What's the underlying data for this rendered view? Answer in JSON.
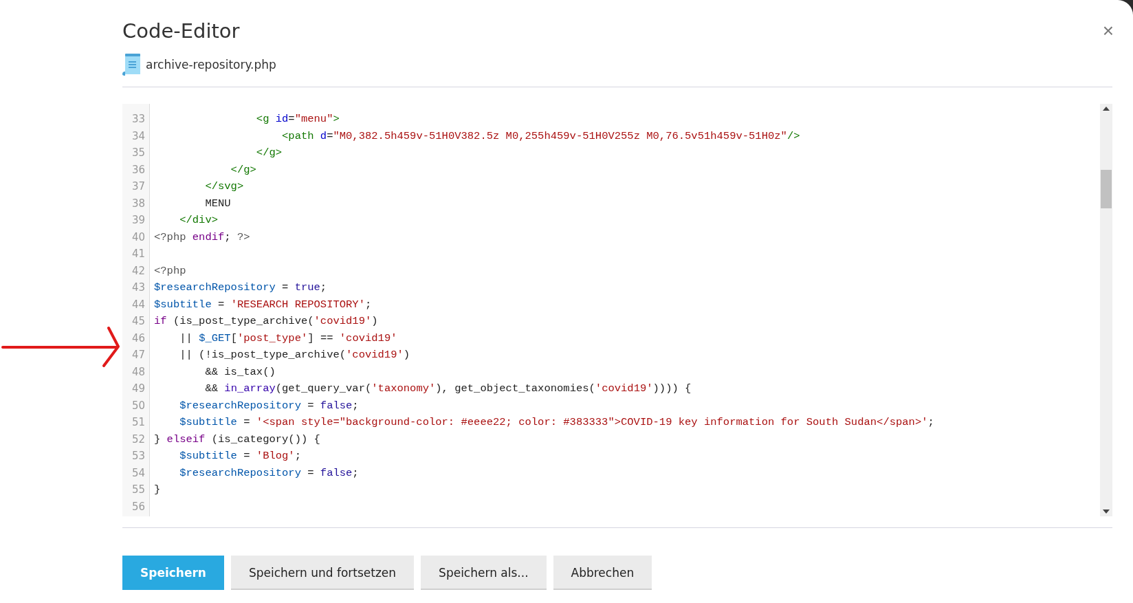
{
  "dialog": {
    "title": "Code-Editor",
    "close": "×",
    "file": {
      "name": "archive-repository.php"
    }
  },
  "editor": {
    "lines": [
      {
        "number": "33",
        "tokens": [
          {
            "kind": "tag",
            "text": "                <g "
          },
          {
            "kind": "attr",
            "text": "id"
          },
          {
            "kind": "plain",
            "text": "="
          },
          {
            "kind": "string",
            "text": "\"menu\""
          },
          {
            "kind": "tag",
            "text": ">"
          }
        ]
      },
      {
        "number": "34",
        "tokens": [
          {
            "kind": "tag",
            "text": "                    <path "
          },
          {
            "kind": "attr",
            "text": "d"
          },
          {
            "kind": "plain",
            "text": "="
          },
          {
            "kind": "string",
            "text": "\"M0,382.5h459v-51H0V382.5z M0,255h459v-51H0V255z M0,76.5v51h459v-51H0z\""
          },
          {
            "kind": "tag",
            "text": "/>"
          }
        ]
      },
      {
        "number": "35",
        "tokens": [
          {
            "kind": "tag",
            "text": "                </g>"
          }
        ]
      },
      {
        "number": "36",
        "tokens": [
          {
            "kind": "tag",
            "text": "            </g>"
          }
        ]
      },
      {
        "number": "37",
        "tokens": [
          {
            "kind": "tag",
            "text": "        </svg>"
          }
        ]
      },
      {
        "number": "38",
        "tokens": [
          {
            "kind": "plain",
            "text": "        MENU"
          }
        ]
      },
      {
        "number": "39",
        "tokens": [
          {
            "kind": "tag",
            "text": "    </div>"
          }
        ]
      },
      {
        "number": "40",
        "tokens": [
          {
            "kind": "meta",
            "text": "<?php "
          },
          {
            "kind": "keyword",
            "text": "endif"
          },
          {
            "kind": "plain",
            "text": "; "
          },
          {
            "kind": "meta",
            "text": "?>"
          }
        ]
      },
      {
        "number": "41"
      },
      {
        "number": "42",
        "tokens": [
          {
            "kind": "meta",
            "text": "<?php"
          }
        ]
      },
      {
        "number": "43",
        "tokens": [
          {
            "kind": "var",
            "text": "$researchRepository"
          },
          {
            "kind": "plain",
            "text": " = "
          },
          {
            "kind": "atom",
            "text": "true"
          },
          {
            "kind": "plain",
            "text": ";"
          }
        ]
      },
      {
        "number": "44",
        "tokens": [
          {
            "kind": "var",
            "text": "$subtitle"
          },
          {
            "kind": "plain",
            "text": " = "
          },
          {
            "kind": "string",
            "text": "'RESEARCH REPOSITORY'"
          },
          {
            "kind": "plain",
            "text": ";"
          }
        ]
      },
      {
        "number": "45",
        "tokens": [
          {
            "kind": "keyword",
            "text": "if"
          },
          {
            "kind": "plain",
            "text": " (is_post_type_archive("
          },
          {
            "kind": "string",
            "text": "'covid19'"
          },
          {
            "kind": "plain",
            "text": ")"
          }
        ]
      },
      {
        "number": "46",
        "tokens": [
          {
            "kind": "plain",
            "text": "    || "
          },
          {
            "kind": "var",
            "text": "$_GET"
          },
          {
            "kind": "plain",
            "text": "["
          },
          {
            "kind": "string",
            "text": "'post_type'"
          },
          {
            "kind": "plain",
            "text": "] == "
          },
          {
            "kind": "string",
            "text": "'covid19'"
          }
        ]
      },
      {
        "number": "47",
        "tokens": [
          {
            "kind": "plain",
            "text": "    || (!is_post_type_archive("
          },
          {
            "kind": "string",
            "text": "'covid19'"
          },
          {
            "kind": "plain",
            "text": ")"
          }
        ]
      },
      {
        "number": "48",
        "tokens": [
          {
            "kind": "plain",
            "text": "        && is_tax()"
          }
        ]
      },
      {
        "number": "49",
        "tokens": [
          {
            "kind": "plain",
            "text": "        && "
          },
          {
            "kind": "builtin",
            "text": "in_array"
          },
          {
            "kind": "plain",
            "text": "(get_query_var("
          },
          {
            "kind": "string",
            "text": "'taxonomy'"
          },
          {
            "kind": "plain",
            "text": "), get_object_taxonomies("
          },
          {
            "kind": "string",
            "text": "'covid19'"
          },
          {
            "kind": "plain",
            "text": ")))) {"
          }
        ]
      },
      {
        "number": "50",
        "tokens": [
          {
            "kind": "var",
            "text": "    $researchRepository"
          },
          {
            "kind": "plain",
            "text": " = "
          },
          {
            "kind": "atom",
            "text": "false"
          },
          {
            "kind": "plain",
            "text": ";"
          }
        ]
      },
      {
        "number": "51",
        "tokens": [
          {
            "kind": "var",
            "text": "    $subtitle"
          },
          {
            "kind": "plain",
            "text": " = "
          },
          {
            "kind": "string",
            "text": "'<span style=\"background-color: #eeee22; color: #383333\">COVID-19 key information for South Sudan</span>'"
          },
          {
            "kind": "plain",
            "text": ";"
          }
        ]
      },
      {
        "number": "52",
        "tokens": [
          {
            "kind": "plain",
            "text": "} "
          },
          {
            "kind": "keyword",
            "text": "elseif"
          },
          {
            "kind": "plain",
            "text": " (is_category()) {"
          }
        ]
      },
      {
        "number": "53",
        "tokens": [
          {
            "kind": "var",
            "text": "    $subtitle"
          },
          {
            "kind": "plain",
            "text": " = "
          },
          {
            "kind": "string",
            "text": "'Blog'"
          },
          {
            "kind": "plain",
            "text": ";"
          }
        ]
      },
      {
        "number": "54",
        "tokens": [
          {
            "kind": "var",
            "text": "    $researchRepository"
          },
          {
            "kind": "plain",
            "text": " = "
          },
          {
            "kind": "atom",
            "text": "false"
          },
          {
            "kind": "plain",
            "text": ";"
          }
        ]
      },
      {
        "number": "55",
        "tokens": [
          {
            "kind": "plain",
            "text": "}"
          }
        ]
      },
      {
        "number": "56"
      }
    ]
  },
  "buttons": [
    {
      "kind": "primary",
      "label": "Speichern"
    },
    {
      "kind": "secondary",
      "label": "Speichern und fortsetzen"
    },
    {
      "kind": "secondary",
      "label": "Speichern als..."
    },
    {
      "kind": "secondary",
      "label": "Abbrechen"
    }
  ]
}
